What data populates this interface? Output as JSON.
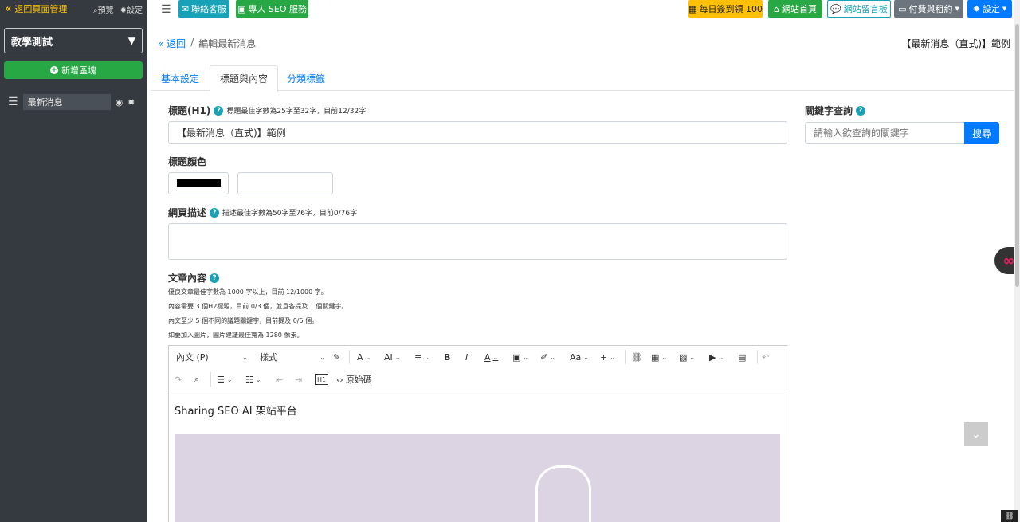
{
  "sidebar": {
    "back_label": "返回頁面管理",
    "preview_label": "預覽",
    "settings_label": "設定",
    "site_name": "教學測試",
    "add_block_label": "新增區塊",
    "items": [
      {
        "label": "最新消息"
      }
    ]
  },
  "topbar": {
    "contact_label": "聯絡客服",
    "seo_service_label": "專人 SEO 服務",
    "checkin_label": "每日簽到領 100",
    "home_label": "網站首頁",
    "guestbook_label": "網站留言板",
    "billing_label": "付費與租約",
    "settings_label": "設定"
  },
  "breadcrumb": {
    "back_label": "返回",
    "separator": "/",
    "current": "編輯最新消息"
  },
  "page_label": "【最新消息（直式)】範例",
  "tabs": [
    {
      "label": "基本設定",
      "active": false
    },
    {
      "label": "標題與內容",
      "active": true
    },
    {
      "label": "分類標籤",
      "active": false
    }
  ],
  "form": {
    "title_label": "標題(H1)",
    "title_hint": "標題最佳字數為25字至32字，目前12/32字",
    "title_value": "【最新消息（直式)】範例",
    "title_color_label": "標題顏色",
    "title_color_value": "#000000",
    "desc_label": "網頁描述",
    "desc_hint": "描述最佳字數為50字至76字，目前0/76字",
    "desc_value": "",
    "content_label": "文章內容",
    "content_notes": [
      "優良文章最佳字數為 1000 字以上，目前 12/1000 字。",
      "內容需要 3 個H2標題，目前 0/3 個，並且各提及 1 個關鍵字。",
      "內文至少 5 個不同的議題關鍵字，目前提及 0/5 個。",
      "如要加入圖片，圖片建議最佳寬為 1280 像素。"
    ]
  },
  "editor": {
    "paragraph_select": "內文 (P)",
    "style_select": "樣式",
    "source_label": "原始碼",
    "body_text": "Sharing SEO AI 架站平台"
  },
  "keyword": {
    "label": "關鍵字查詢",
    "placeholder": "請輸入欲查詢的關鍵字",
    "search_label": "搜尋"
  },
  "colors": {
    "sidebar_bg": "#343a40",
    "accent_blue": "#007bff",
    "accent_green": "#28a745",
    "accent_teal": "#17a2b8",
    "accent_yellow": "#ffc107"
  }
}
